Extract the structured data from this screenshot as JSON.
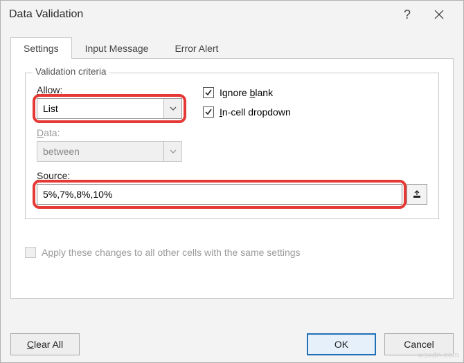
{
  "titlebar": {
    "title": "Data Validation",
    "help": "?"
  },
  "tabs": {
    "settings": "Settings",
    "input_message": "Input Message",
    "error_alert": "Error Alert"
  },
  "criteria": {
    "legend": "Validation criteria",
    "allow_label": "Allow:",
    "allow_value": "List",
    "data_label": "Data:",
    "data_value": "between",
    "source_label": "Source:",
    "source_value": "5%,7%,8%,10%",
    "ignore_blank": "Ignore blank",
    "incell_dropdown": "In-cell dropdown"
  },
  "apply_text": "Apply these changes to all other cells with the same settings",
  "buttons": {
    "clear_all": "Clear All",
    "ok": "OK",
    "cancel": "Cancel"
  },
  "watermark": "wsxdn.com"
}
